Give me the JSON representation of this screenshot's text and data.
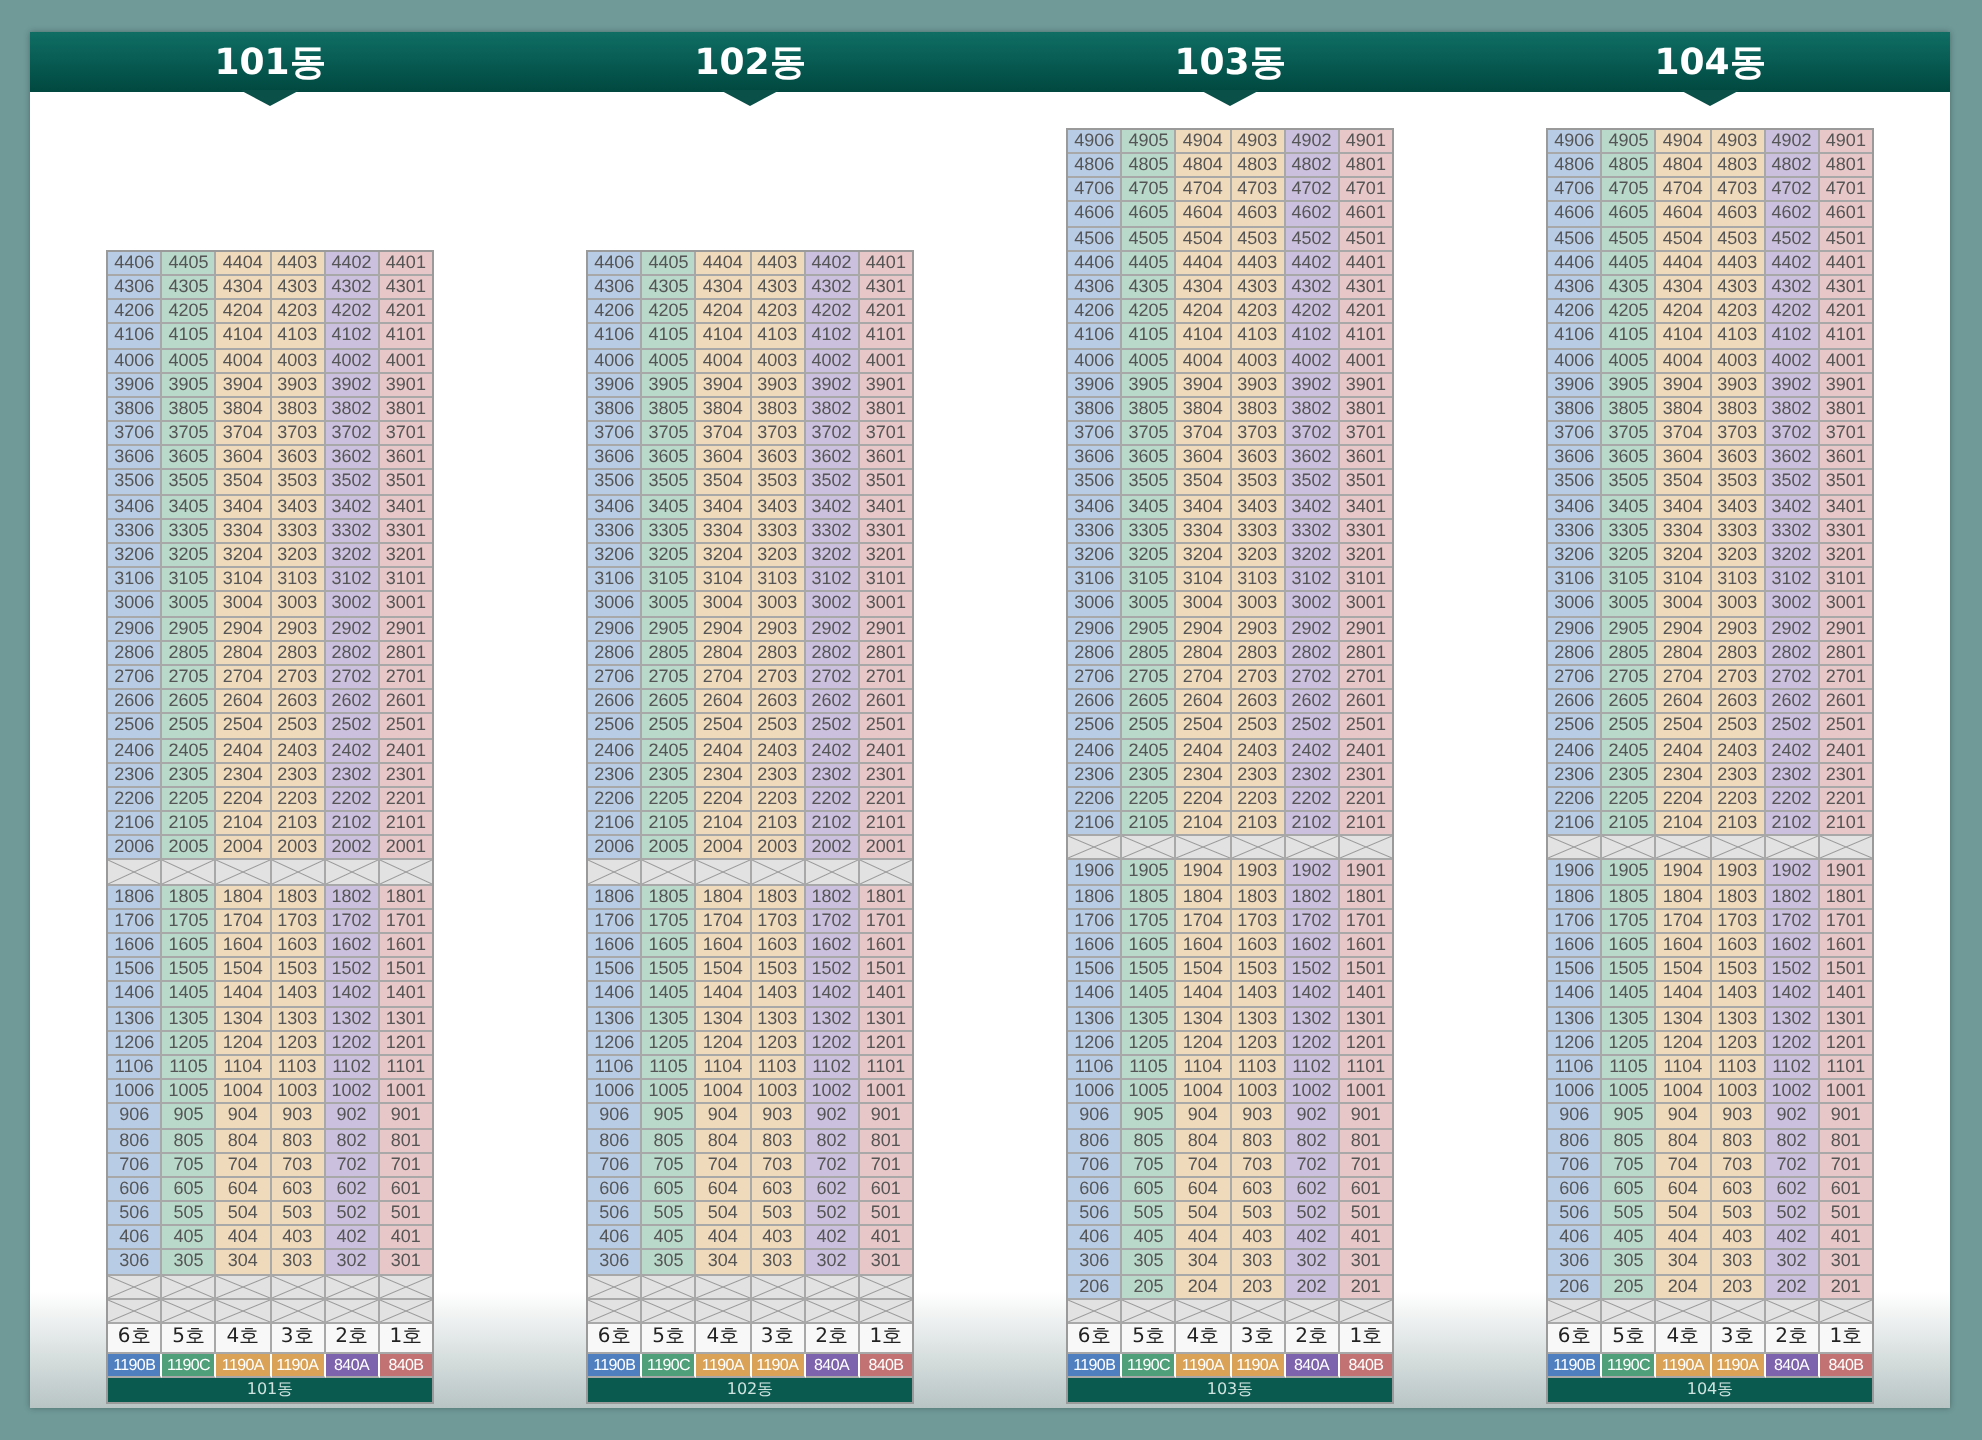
{
  "buildings": [
    {
      "title": "101동",
      "footer_label": "101동",
      "columns": [
        {
          "label": "6호",
          "type": "1190B",
          "color": "#4f7fbf"
        },
        {
          "label": "5호",
          "type": "1190C",
          "color": "#4f9f7a"
        },
        {
          "label": "4호",
          "type": "1190A",
          "color": "#d9a257"
        },
        {
          "label": "3호",
          "type": "1190A",
          "color": "#d9a257"
        },
        {
          "label": "2호",
          "type": "840A",
          "color": "#7d62ad"
        },
        {
          "label": "1호",
          "type": "840B",
          "color": "#c27272"
        }
      ],
      "floors": [
        {
          "kind": "units",
          "units": [
            "4406",
            "4405",
            "4404",
            "4403",
            "4402",
            "4401"
          ]
        },
        {
          "kind": "units",
          "units": [
            "4306",
            "4305",
            "4304",
            "4303",
            "4302",
            "4301"
          ]
        },
        {
          "kind": "units",
          "units": [
            "4206",
            "4205",
            "4204",
            "4203",
            "4202",
            "4201"
          ]
        },
        {
          "kind": "units",
          "units": [
            "4106",
            "4105",
            "4104",
            "4103",
            "4102",
            "4101"
          ]
        },
        {
          "kind": "units",
          "units": [
            "4006",
            "4005",
            "4004",
            "4003",
            "4002",
            "4001"
          ]
        },
        {
          "kind": "units",
          "units": [
            "3906",
            "3905",
            "3904",
            "3903",
            "3902",
            "3901"
          ]
        },
        {
          "kind": "units",
          "units": [
            "3806",
            "3805",
            "3804",
            "3803",
            "3802",
            "3801"
          ]
        },
        {
          "kind": "units",
          "units": [
            "3706",
            "3705",
            "3704",
            "3703",
            "3702",
            "3701"
          ]
        },
        {
          "kind": "units",
          "units": [
            "3606",
            "3605",
            "3604",
            "3603",
            "3602",
            "3601"
          ]
        },
        {
          "kind": "units",
          "units": [
            "3506",
            "3505",
            "3504",
            "3503",
            "3502",
            "3501"
          ]
        },
        {
          "kind": "units",
          "units": [
            "3406",
            "3405",
            "3404",
            "3403",
            "3402",
            "3401"
          ]
        },
        {
          "kind": "units",
          "units": [
            "3306",
            "3305",
            "3304",
            "3303",
            "3302",
            "3301"
          ]
        },
        {
          "kind": "units",
          "units": [
            "3206",
            "3205",
            "3204",
            "3203",
            "3202",
            "3201"
          ]
        },
        {
          "kind": "units",
          "units": [
            "3106",
            "3105",
            "3104",
            "3103",
            "3102",
            "3101"
          ]
        },
        {
          "kind": "units",
          "units": [
            "3006",
            "3005",
            "3004",
            "3003",
            "3002",
            "3001"
          ]
        },
        {
          "kind": "units",
          "units": [
            "2906",
            "2905",
            "2904",
            "2903",
            "2902",
            "2901"
          ]
        },
        {
          "kind": "units",
          "units": [
            "2806",
            "2805",
            "2804",
            "2803",
            "2802",
            "2801"
          ]
        },
        {
          "kind": "units",
          "units": [
            "2706",
            "2705",
            "2704",
            "2703",
            "2702",
            "2701"
          ]
        },
        {
          "kind": "units",
          "units": [
            "2606",
            "2605",
            "2604",
            "2603",
            "2602",
            "2601"
          ]
        },
        {
          "kind": "units",
          "units": [
            "2506",
            "2505",
            "2504",
            "2503",
            "2502",
            "2501"
          ]
        },
        {
          "kind": "units",
          "units": [
            "2406",
            "2405",
            "2404",
            "2403",
            "2402",
            "2401"
          ]
        },
        {
          "kind": "units",
          "units": [
            "2306",
            "2305",
            "2304",
            "2303",
            "2302",
            "2301"
          ]
        },
        {
          "kind": "units",
          "units": [
            "2206",
            "2205",
            "2204",
            "2203",
            "2202",
            "2201"
          ]
        },
        {
          "kind": "units",
          "units": [
            "2106",
            "2105",
            "2104",
            "2103",
            "2102",
            "2101"
          ]
        },
        {
          "kind": "units",
          "units": [
            "2006",
            "2005",
            "2004",
            "2003",
            "2002",
            "2001"
          ]
        },
        {
          "kind": "blocked"
        },
        {
          "kind": "units",
          "units": [
            "1806",
            "1805",
            "1804",
            "1803",
            "1802",
            "1801"
          ]
        },
        {
          "kind": "units",
          "units": [
            "1706",
            "1705",
            "1704",
            "1703",
            "1702",
            "1701"
          ]
        },
        {
          "kind": "units",
          "units": [
            "1606",
            "1605",
            "1604",
            "1603",
            "1602",
            "1601"
          ]
        },
        {
          "kind": "units",
          "units": [
            "1506",
            "1505",
            "1504",
            "1503",
            "1502",
            "1501"
          ]
        },
        {
          "kind": "units",
          "units": [
            "1406",
            "1405",
            "1404",
            "1403",
            "1402",
            "1401"
          ]
        },
        {
          "kind": "units",
          "units": [
            "1306",
            "1305",
            "1304",
            "1303",
            "1302",
            "1301"
          ]
        },
        {
          "kind": "units",
          "units": [
            "1206",
            "1205",
            "1204",
            "1203",
            "1202",
            "1201"
          ]
        },
        {
          "kind": "units",
          "units": [
            "1106",
            "1105",
            "1104",
            "1103",
            "1102",
            "1101"
          ]
        },
        {
          "kind": "units",
          "units": [
            "1006",
            "1005",
            "1004",
            "1003",
            "1002",
            "1001"
          ]
        },
        {
          "kind": "units",
          "units": [
            "906",
            "905",
            "904",
            "903",
            "902",
            "901"
          ]
        },
        {
          "kind": "units",
          "units": [
            "806",
            "805",
            "804",
            "803",
            "802",
            "801"
          ]
        },
        {
          "kind": "units",
          "units": [
            "706",
            "705",
            "704",
            "703",
            "702",
            "701"
          ]
        },
        {
          "kind": "units",
          "units": [
            "606",
            "605",
            "604",
            "603",
            "602",
            "601"
          ]
        },
        {
          "kind": "units",
          "units": [
            "506",
            "505",
            "504",
            "503",
            "502",
            "501"
          ]
        },
        {
          "kind": "units",
          "units": [
            "406",
            "405",
            "404",
            "403",
            "402",
            "401"
          ]
        },
        {
          "kind": "units",
          "units": [
            "306",
            "305",
            "304",
            "303",
            "302",
            "301"
          ]
        },
        {
          "kind": "blocked"
        },
        {
          "kind": "blocked"
        }
      ]
    },
    {
      "title": "102동",
      "footer_label": "102동",
      "columns": [
        {
          "label": "6호",
          "type": "1190B",
          "color": "#4f7fbf"
        },
        {
          "label": "5호",
          "type": "1190C",
          "color": "#4f9f7a"
        },
        {
          "label": "4호",
          "type": "1190A",
          "color": "#d9a257"
        },
        {
          "label": "3호",
          "type": "1190A",
          "color": "#d9a257"
        },
        {
          "label": "2호",
          "type": "840A",
          "color": "#7d62ad"
        },
        {
          "label": "1호",
          "type": "840B",
          "color": "#c27272"
        }
      ],
      "floors": [
        {
          "kind": "units",
          "units": [
            "4406",
            "4405",
            "4404",
            "4403",
            "4402",
            "4401"
          ]
        },
        {
          "kind": "units",
          "units": [
            "4306",
            "4305",
            "4304",
            "4303",
            "4302",
            "4301"
          ]
        },
        {
          "kind": "units",
          "units": [
            "4206",
            "4205",
            "4204",
            "4203",
            "4202",
            "4201"
          ]
        },
        {
          "kind": "units",
          "units": [
            "4106",
            "4105",
            "4104",
            "4103",
            "4102",
            "4101"
          ]
        },
        {
          "kind": "units",
          "units": [
            "4006",
            "4005",
            "4004",
            "4003",
            "4002",
            "4001"
          ]
        },
        {
          "kind": "units",
          "units": [
            "3906",
            "3905",
            "3904",
            "3903",
            "3902",
            "3901"
          ]
        },
        {
          "kind": "units",
          "units": [
            "3806",
            "3805",
            "3804",
            "3803",
            "3802",
            "3801"
          ]
        },
        {
          "kind": "units",
          "units": [
            "3706",
            "3705",
            "3704",
            "3703",
            "3702",
            "3701"
          ]
        },
        {
          "kind": "units",
          "units": [
            "3606",
            "3605",
            "3604",
            "3603",
            "3602",
            "3601"
          ]
        },
        {
          "kind": "units",
          "units": [
            "3506",
            "3505",
            "3504",
            "3503",
            "3502",
            "3501"
          ]
        },
        {
          "kind": "units",
          "units": [
            "3406",
            "3405",
            "3404",
            "3403",
            "3402",
            "3401"
          ]
        },
        {
          "kind": "units",
          "units": [
            "3306",
            "3305",
            "3304",
            "3303",
            "3302",
            "3301"
          ]
        },
        {
          "kind": "units",
          "units": [
            "3206",
            "3205",
            "3204",
            "3203",
            "3202",
            "3201"
          ]
        },
        {
          "kind": "units",
          "units": [
            "3106",
            "3105",
            "3104",
            "3103",
            "3102",
            "3101"
          ]
        },
        {
          "kind": "units",
          "units": [
            "3006",
            "3005",
            "3004",
            "3003",
            "3002",
            "3001"
          ]
        },
        {
          "kind": "units",
          "units": [
            "2906",
            "2905",
            "2904",
            "2903",
            "2902",
            "2901"
          ]
        },
        {
          "kind": "units",
          "units": [
            "2806",
            "2805",
            "2804",
            "2803",
            "2802",
            "2801"
          ]
        },
        {
          "kind": "units",
          "units": [
            "2706",
            "2705",
            "2704",
            "2703",
            "2702",
            "2701"
          ]
        },
        {
          "kind": "units",
          "units": [
            "2606",
            "2605",
            "2604",
            "2603",
            "2602",
            "2601"
          ]
        },
        {
          "kind": "units",
          "units": [
            "2506",
            "2505",
            "2504",
            "2503",
            "2502",
            "2501"
          ]
        },
        {
          "kind": "units",
          "units": [
            "2406",
            "2405",
            "2404",
            "2403",
            "2402",
            "2401"
          ]
        },
        {
          "kind": "units",
          "units": [
            "2306",
            "2305",
            "2304",
            "2303",
            "2302",
            "2301"
          ]
        },
        {
          "kind": "units",
          "units": [
            "2206",
            "2205",
            "2204",
            "2203",
            "2202",
            "2201"
          ]
        },
        {
          "kind": "units",
          "units": [
            "2106",
            "2105",
            "2104",
            "2103",
            "2102",
            "2101"
          ]
        },
        {
          "kind": "units",
          "units": [
            "2006",
            "2005",
            "2004",
            "2003",
            "2002",
            "2001"
          ]
        },
        {
          "kind": "blocked"
        },
        {
          "kind": "units",
          "units": [
            "1806",
            "1805",
            "1804",
            "1803",
            "1802",
            "1801"
          ]
        },
        {
          "kind": "units",
          "units": [
            "1706",
            "1705",
            "1704",
            "1703",
            "1702",
            "1701"
          ]
        },
        {
          "kind": "units",
          "units": [
            "1606",
            "1605",
            "1604",
            "1603",
            "1602",
            "1601"
          ]
        },
        {
          "kind": "units",
          "units": [
            "1506",
            "1505",
            "1504",
            "1503",
            "1502",
            "1501"
          ]
        },
        {
          "kind": "units",
          "units": [
            "1406",
            "1405",
            "1404",
            "1403",
            "1402",
            "1401"
          ]
        },
        {
          "kind": "units",
          "units": [
            "1306",
            "1305",
            "1304",
            "1303",
            "1302",
            "1301"
          ]
        },
        {
          "kind": "units",
          "units": [
            "1206",
            "1205",
            "1204",
            "1203",
            "1202",
            "1201"
          ]
        },
        {
          "kind": "units",
          "units": [
            "1106",
            "1105",
            "1104",
            "1103",
            "1102",
            "1101"
          ]
        },
        {
          "kind": "units",
          "units": [
            "1006",
            "1005",
            "1004",
            "1003",
            "1002",
            "1001"
          ]
        },
        {
          "kind": "units",
          "units": [
            "906",
            "905",
            "904",
            "903",
            "902",
            "901"
          ]
        },
        {
          "kind": "units",
          "units": [
            "806",
            "805",
            "804",
            "803",
            "802",
            "801"
          ]
        },
        {
          "kind": "units",
          "units": [
            "706",
            "705",
            "704",
            "703",
            "702",
            "701"
          ]
        },
        {
          "kind": "units",
          "units": [
            "606",
            "605",
            "604",
            "603",
            "602",
            "601"
          ]
        },
        {
          "kind": "units",
          "units": [
            "506",
            "505",
            "504",
            "503",
            "502",
            "501"
          ]
        },
        {
          "kind": "units",
          "units": [
            "406",
            "405",
            "404",
            "403",
            "402",
            "401"
          ]
        },
        {
          "kind": "units",
          "units": [
            "306",
            "305",
            "304",
            "303",
            "302",
            "301"
          ]
        },
        {
          "kind": "blocked"
        },
        {
          "kind": "blocked"
        }
      ]
    },
    {
      "title": "103동",
      "footer_label": "103동",
      "columns": [
        {
          "label": "6호",
          "type": "1190B",
          "color": "#4f7fbf"
        },
        {
          "label": "5호",
          "type": "1190C",
          "color": "#4f9f7a"
        },
        {
          "label": "4호",
          "type": "1190A",
          "color": "#d9a257"
        },
        {
          "label": "3호",
          "type": "1190A",
          "color": "#d9a257"
        },
        {
          "label": "2호",
          "type": "840A",
          "color": "#7d62ad"
        },
        {
          "label": "1호",
          "type": "840B",
          "color": "#c27272"
        }
      ],
      "floors": [
        {
          "kind": "units",
          "units": [
            "4906",
            "4905",
            "4904",
            "4903",
            "4902",
            "4901"
          ]
        },
        {
          "kind": "units",
          "units": [
            "4806",
            "4805",
            "4804",
            "4803",
            "4802",
            "4801"
          ]
        },
        {
          "kind": "units",
          "units": [
            "4706",
            "4705",
            "4704",
            "4703",
            "4702",
            "4701"
          ]
        },
        {
          "kind": "units",
          "units": [
            "4606",
            "4605",
            "4604",
            "4603",
            "4602",
            "4601"
          ]
        },
        {
          "kind": "units",
          "units": [
            "4506",
            "4505",
            "4504",
            "4503",
            "4502",
            "4501"
          ]
        },
        {
          "kind": "units",
          "units": [
            "4406",
            "4405",
            "4404",
            "4403",
            "4402",
            "4401"
          ]
        },
        {
          "kind": "units",
          "units": [
            "4306",
            "4305",
            "4304",
            "4303",
            "4302",
            "4301"
          ]
        },
        {
          "kind": "units",
          "units": [
            "4206",
            "4205",
            "4204",
            "4203",
            "4202",
            "4201"
          ]
        },
        {
          "kind": "units",
          "units": [
            "4106",
            "4105",
            "4104",
            "4103",
            "4102",
            "4101"
          ]
        },
        {
          "kind": "units",
          "units": [
            "4006",
            "4005",
            "4004",
            "4003",
            "4002",
            "4001"
          ]
        },
        {
          "kind": "units",
          "units": [
            "3906",
            "3905",
            "3904",
            "3903",
            "3902",
            "3901"
          ]
        },
        {
          "kind": "units",
          "units": [
            "3806",
            "3805",
            "3804",
            "3803",
            "3802",
            "3801"
          ]
        },
        {
          "kind": "units",
          "units": [
            "3706",
            "3705",
            "3704",
            "3703",
            "3702",
            "3701"
          ]
        },
        {
          "kind": "units",
          "units": [
            "3606",
            "3605",
            "3604",
            "3603",
            "3602",
            "3601"
          ]
        },
        {
          "kind": "units",
          "units": [
            "3506",
            "3505",
            "3504",
            "3503",
            "3502",
            "3501"
          ]
        },
        {
          "kind": "units",
          "units": [
            "3406",
            "3405",
            "3404",
            "3403",
            "3402",
            "3401"
          ]
        },
        {
          "kind": "units",
          "units": [
            "3306",
            "3305",
            "3304",
            "3303",
            "3302",
            "3301"
          ]
        },
        {
          "kind": "units",
          "units": [
            "3206",
            "3205",
            "3204",
            "3203",
            "3202",
            "3201"
          ]
        },
        {
          "kind": "units",
          "units": [
            "3106",
            "3105",
            "3104",
            "3103",
            "3102",
            "3101"
          ]
        },
        {
          "kind": "units",
          "units": [
            "3006",
            "3005",
            "3004",
            "3003",
            "3002",
            "3001"
          ]
        },
        {
          "kind": "units",
          "units": [
            "2906",
            "2905",
            "2904",
            "2903",
            "2902",
            "2901"
          ]
        },
        {
          "kind": "units",
          "units": [
            "2806",
            "2805",
            "2804",
            "2803",
            "2802",
            "2801"
          ]
        },
        {
          "kind": "units",
          "units": [
            "2706",
            "2705",
            "2704",
            "2703",
            "2702",
            "2701"
          ]
        },
        {
          "kind": "units",
          "units": [
            "2606",
            "2605",
            "2604",
            "2603",
            "2602",
            "2601"
          ]
        },
        {
          "kind": "units",
          "units": [
            "2506",
            "2505",
            "2504",
            "2503",
            "2502",
            "2501"
          ]
        },
        {
          "kind": "units",
          "units": [
            "2406",
            "2405",
            "2404",
            "2403",
            "2402",
            "2401"
          ]
        },
        {
          "kind": "units",
          "units": [
            "2306",
            "2305",
            "2304",
            "2303",
            "2302",
            "2301"
          ]
        },
        {
          "kind": "units",
          "units": [
            "2206",
            "2205",
            "2204",
            "2203",
            "2202",
            "2201"
          ]
        },
        {
          "kind": "units",
          "units": [
            "2106",
            "2105",
            "2104",
            "2103",
            "2102",
            "2101"
          ]
        },
        {
          "kind": "blocked"
        },
        {
          "kind": "units",
          "units": [
            "1906",
            "1905",
            "1904",
            "1903",
            "1902",
            "1901"
          ]
        },
        {
          "kind": "units",
          "units": [
            "1806",
            "1805",
            "1804",
            "1803",
            "1802",
            "1801"
          ]
        },
        {
          "kind": "units",
          "units": [
            "1706",
            "1705",
            "1704",
            "1703",
            "1702",
            "1701"
          ]
        },
        {
          "kind": "units",
          "units": [
            "1606",
            "1605",
            "1604",
            "1603",
            "1602",
            "1601"
          ]
        },
        {
          "kind": "units",
          "units": [
            "1506",
            "1505",
            "1504",
            "1503",
            "1502",
            "1501"
          ]
        },
        {
          "kind": "units",
          "units": [
            "1406",
            "1405",
            "1404",
            "1403",
            "1402",
            "1401"
          ]
        },
        {
          "kind": "units",
          "units": [
            "1306",
            "1305",
            "1304",
            "1303",
            "1302",
            "1301"
          ]
        },
        {
          "kind": "units",
          "units": [
            "1206",
            "1205",
            "1204",
            "1203",
            "1202",
            "1201"
          ]
        },
        {
          "kind": "units",
          "units": [
            "1106",
            "1105",
            "1104",
            "1103",
            "1102",
            "1101"
          ]
        },
        {
          "kind": "units",
          "units": [
            "1006",
            "1005",
            "1004",
            "1003",
            "1002",
            "1001"
          ]
        },
        {
          "kind": "units",
          "units": [
            "906",
            "905",
            "904",
            "903",
            "902",
            "901"
          ]
        },
        {
          "kind": "units",
          "units": [
            "806",
            "805",
            "804",
            "803",
            "802",
            "801"
          ]
        },
        {
          "kind": "units",
          "units": [
            "706",
            "705",
            "704",
            "703",
            "702",
            "701"
          ]
        },
        {
          "kind": "units",
          "units": [
            "606",
            "605",
            "604",
            "603",
            "602",
            "601"
          ]
        },
        {
          "kind": "units",
          "units": [
            "506",
            "505",
            "504",
            "503",
            "502",
            "501"
          ]
        },
        {
          "kind": "units",
          "units": [
            "406",
            "405",
            "404",
            "403",
            "402",
            "401"
          ]
        },
        {
          "kind": "units",
          "units": [
            "306",
            "305",
            "304",
            "303",
            "302",
            "301"
          ]
        },
        {
          "kind": "units",
          "units": [
            "206",
            "205",
            "204",
            "203",
            "202",
            "201"
          ]
        },
        {
          "kind": "blocked"
        }
      ]
    },
    {
      "title": "104동",
      "footer_label": "104동",
      "columns": [
        {
          "label": "6호",
          "type": "1190B",
          "color": "#4f7fbf"
        },
        {
          "label": "5호",
          "type": "1190C",
          "color": "#4f9f7a"
        },
        {
          "label": "4호",
          "type": "1190A",
          "color": "#d9a257"
        },
        {
          "label": "3호",
          "type": "1190A",
          "color": "#d9a257"
        },
        {
          "label": "2호",
          "type": "840A",
          "color": "#7d62ad"
        },
        {
          "label": "1호",
          "type": "840B",
          "color": "#c27272"
        }
      ],
      "floors": [
        {
          "kind": "units",
          "units": [
            "4906",
            "4905",
            "4904",
            "4903",
            "4902",
            "4901"
          ]
        },
        {
          "kind": "units",
          "units": [
            "4806",
            "4805",
            "4804",
            "4803",
            "4802",
            "4801"
          ]
        },
        {
          "kind": "units",
          "units": [
            "4706",
            "4705",
            "4704",
            "4703",
            "4702",
            "4701"
          ]
        },
        {
          "kind": "units",
          "units": [
            "4606",
            "4605",
            "4604",
            "4603",
            "4602",
            "4601"
          ]
        },
        {
          "kind": "units",
          "units": [
            "4506",
            "4505",
            "4504",
            "4503",
            "4502",
            "4501"
          ]
        },
        {
          "kind": "units",
          "units": [
            "4406",
            "4405",
            "4404",
            "4403",
            "4402",
            "4401"
          ]
        },
        {
          "kind": "units",
          "units": [
            "4306",
            "4305",
            "4304",
            "4303",
            "4302",
            "4301"
          ]
        },
        {
          "kind": "units",
          "units": [
            "4206",
            "4205",
            "4204",
            "4203",
            "4202",
            "4201"
          ]
        },
        {
          "kind": "units",
          "units": [
            "4106",
            "4105",
            "4104",
            "4103",
            "4102",
            "4101"
          ]
        },
        {
          "kind": "units",
          "units": [
            "4006",
            "4005",
            "4004",
            "4003",
            "4002",
            "4001"
          ]
        },
        {
          "kind": "units",
          "units": [
            "3906",
            "3905",
            "3904",
            "3903",
            "3902",
            "3901"
          ]
        },
        {
          "kind": "units",
          "units": [
            "3806",
            "3805",
            "3804",
            "3803",
            "3802",
            "3801"
          ]
        },
        {
          "kind": "units",
          "units": [
            "3706",
            "3705",
            "3704",
            "3703",
            "3702",
            "3701"
          ]
        },
        {
          "kind": "units",
          "units": [
            "3606",
            "3605",
            "3604",
            "3603",
            "3602",
            "3601"
          ]
        },
        {
          "kind": "units",
          "units": [
            "3506",
            "3505",
            "3504",
            "3503",
            "3502",
            "3501"
          ]
        },
        {
          "kind": "units",
          "units": [
            "3406",
            "3405",
            "3404",
            "3403",
            "3402",
            "3401"
          ]
        },
        {
          "kind": "units",
          "units": [
            "3306",
            "3305",
            "3304",
            "3303",
            "3302",
            "3301"
          ]
        },
        {
          "kind": "units",
          "units": [
            "3206",
            "3205",
            "3204",
            "3203",
            "3202",
            "3201"
          ]
        },
        {
          "kind": "units",
          "units": [
            "3106",
            "3105",
            "3104",
            "3103",
            "3102",
            "3101"
          ]
        },
        {
          "kind": "units",
          "units": [
            "3006",
            "3005",
            "3004",
            "3003",
            "3002",
            "3001"
          ]
        },
        {
          "kind": "units",
          "units": [
            "2906",
            "2905",
            "2904",
            "2903",
            "2902",
            "2901"
          ]
        },
        {
          "kind": "units",
          "units": [
            "2806",
            "2805",
            "2804",
            "2803",
            "2802",
            "2801"
          ]
        },
        {
          "kind": "units",
          "units": [
            "2706",
            "2705",
            "2704",
            "2703",
            "2702",
            "2701"
          ]
        },
        {
          "kind": "units",
          "units": [
            "2606",
            "2605",
            "2604",
            "2603",
            "2602",
            "2601"
          ]
        },
        {
          "kind": "units",
          "units": [
            "2506",
            "2505",
            "2504",
            "2503",
            "2502",
            "2501"
          ]
        },
        {
          "kind": "units",
          "units": [
            "2406",
            "2405",
            "2404",
            "2403",
            "2402",
            "2401"
          ]
        },
        {
          "kind": "units",
          "units": [
            "2306",
            "2305",
            "2304",
            "2303",
            "2302",
            "2301"
          ]
        },
        {
          "kind": "units",
          "units": [
            "2206",
            "2205",
            "2204",
            "2203",
            "2202",
            "2201"
          ]
        },
        {
          "kind": "units",
          "units": [
            "2106",
            "2105",
            "2104",
            "2103",
            "2102",
            "2101"
          ]
        },
        {
          "kind": "blocked"
        },
        {
          "kind": "units",
          "units": [
            "1906",
            "1905",
            "1904",
            "1903",
            "1902",
            "1901"
          ]
        },
        {
          "kind": "units",
          "units": [
            "1806",
            "1805",
            "1804",
            "1803",
            "1802",
            "1801"
          ]
        },
        {
          "kind": "units",
          "units": [
            "1706",
            "1705",
            "1704",
            "1703",
            "1702",
            "1701"
          ]
        },
        {
          "kind": "units",
          "units": [
            "1606",
            "1605",
            "1604",
            "1603",
            "1602",
            "1601"
          ]
        },
        {
          "kind": "units",
          "units": [
            "1506",
            "1505",
            "1504",
            "1503",
            "1502",
            "1501"
          ]
        },
        {
          "kind": "units",
          "units": [
            "1406",
            "1405",
            "1404",
            "1403",
            "1402",
            "1401"
          ]
        },
        {
          "kind": "units",
          "units": [
            "1306",
            "1305",
            "1304",
            "1303",
            "1302",
            "1301"
          ]
        },
        {
          "kind": "units",
          "units": [
            "1206",
            "1205",
            "1204",
            "1203",
            "1202",
            "1201"
          ]
        },
        {
          "kind": "units",
          "units": [
            "1106",
            "1105",
            "1104",
            "1103",
            "1102",
            "1101"
          ]
        },
        {
          "kind": "units",
          "units": [
            "1006",
            "1005",
            "1004",
            "1003",
            "1002",
            "1001"
          ]
        },
        {
          "kind": "units",
          "units": [
            "906",
            "905",
            "904",
            "903",
            "902",
            "901"
          ]
        },
        {
          "kind": "units",
          "units": [
            "806",
            "805",
            "804",
            "803",
            "802",
            "801"
          ]
        },
        {
          "kind": "units",
          "units": [
            "706",
            "705",
            "704",
            "703",
            "702",
            "701"
          ]
        },
        {
          "kind": "units",
          "units": [
            "606",
            "605",
            "604",
            "603",
            "602",
            "601"
          ]
        },
        {
          "kind": "units",
          "units": [
            "506",
            "505",
            "504",
            "503",
            "502",
            "501"
          ]
        },
        {
          "kind": "units",
          "units": [
            "406",
            "405",
            "404",
            "403",
            "402",
            "401"
          ]
        },
        {
          "kind": "units",
          "units": [
            "306",
            "305",
            "304",
            "303",
            "302",
            "301"
          ]
        },
        {
          "kind": "units",
          "units": [
            "206",
            "205",
            "204",
            "203",
            "202",
            "201"
          ]
        },
        {
          "kind": "blocked"
        }
      ]
    }
  ]
}
